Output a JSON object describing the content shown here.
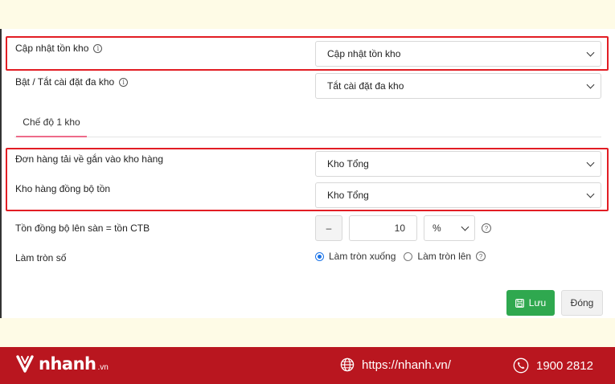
{
  "form": {
    "update_stock": {
      "label": "Cập nhật tồn kho",
      "value": "Cập nhật tồn kho"
    },
    "multi_warehouse": {
      "label": "Bật / Tắt cài đặt đa kho",
      "value": "Tắt cài đặt đa kho"
    },
    "tab_label": "Chế độ 1 kho",
    "order_warehouse": {
      "label": "Đơn hàng tải về gắn vào kho hàng",
      "value": "Kho Tổng"
    },
    "sync_warehouse": {
      "label": "Kho hàng đồng bộ tồn",
      "value": "Kho Tổng"
    },
    "stock_sync": {
      "label": "Tồn đồng bộ lên sàn = tồn CTB",
      "minus": "–",
      "amount": "10",
      "unit": "%"
    },
    "rounding": {
      "label": "Làm tròn số",
      "option_down": "Làm tròn xuống",
      "option_up": "Làm tròn lên",
      "selected": "down"
    },
    "save_label": "Lưu",
    "close_label": "Đóng"
  },
  "footer": {
    "brand": "nhanh",
    "brand_suffix": ".vn",
    "website": "https://nhanh.vn/",
    "phone": "1900 2812"
  },
  "colors": {
    "highlight": "#e21d24",
    "tab_accent": "#ee6b8a",
    "save": "#2fa84f",
    "footer": "#b9161f",
    "radio": "#1a73e8"
  },
  "icons": [
    "info-icon",
    "chevron-down-icon",
    "help-icon",
    "save-icon",
    "nhanh-logo-icon",
    "globe-icon",
    "phone-icon"
  ]
}
